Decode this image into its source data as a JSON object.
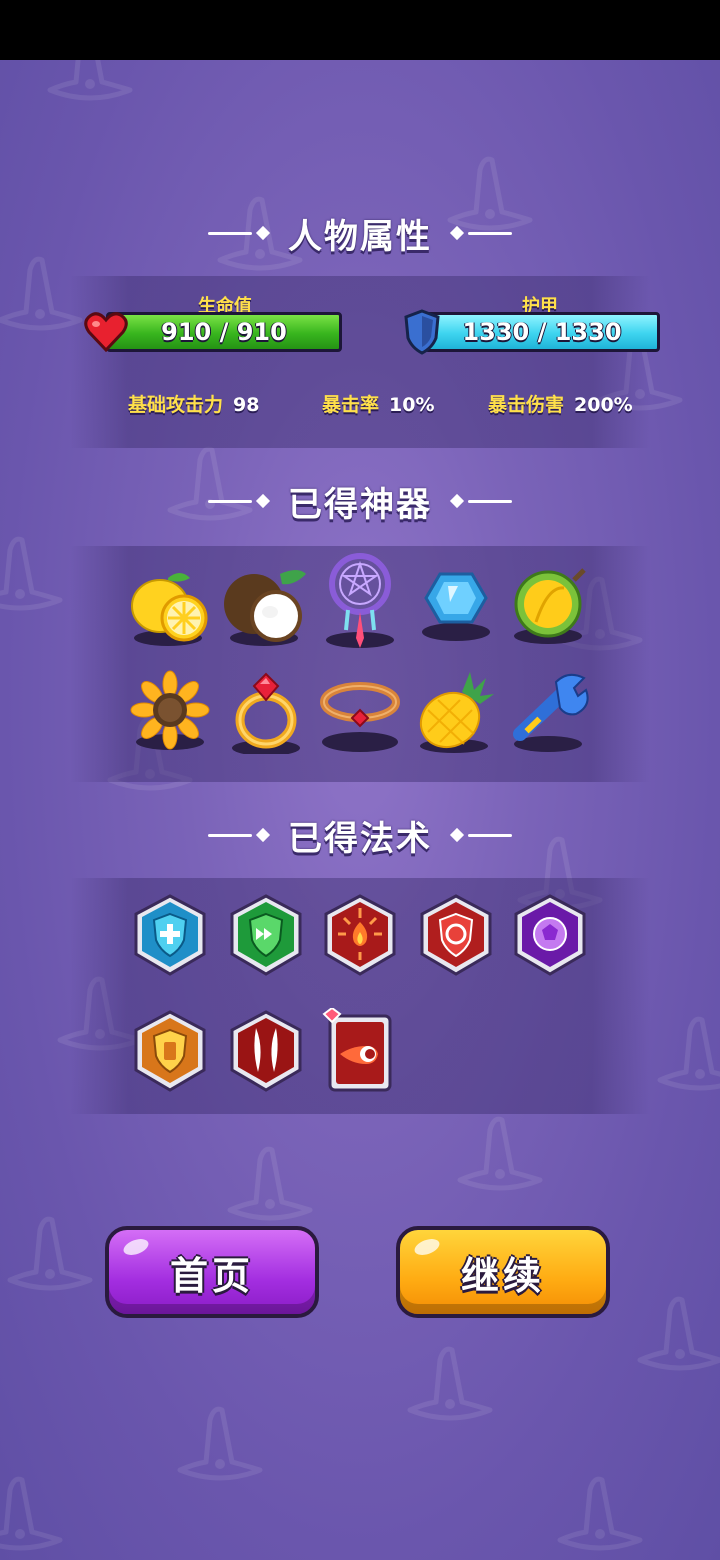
{
  "sections": {
    "attributes_title": "人物属性",
    "artifacts_title": "已得神器",
    "spells_title": "已得法术"
  },
  "stats": {
    "hp_label": "生命值",
    "hp_value": "910 / 910",
    "armor_label": "护甲",
    "armor_value": "1330 / 1330",
    "attack_label": "基础攻击力",
    "attack_value": "98",
    "crit_rate_label": "暴击率",
    "crit_rate_value": "10%",
    "crit_damage_label": "暴击伤害",
    "crit_damage_value": "200%"
  },
  "artifacts": [
    {
      "icon": "lemon-icon"
    },
    {
      "icon": "coconut-icon"
    },
    {
      "icon": "dreamcatcher-icon"
    },
    {
      "icon": "blue-gem-icon"
    },
    {
      "icon": "durian-icon"
    },
    {
      "icon": "sunflower-icon"
    },
    {
      "icon": "ruby-ring-icon"
    },
    {
      "icon": "bracelet-icon"
    },
    {
      "icon": "pineapple-icon"
    },
    {
      "icon": "wrench-icon"
    }
  ],
  "spells": [
    {
      "icon": "heal-shield-icon"
    },
    {
      "icon": "speed-shield-icon"
    },
    {
      "icon": "fire-burst-icon"
    },
    {
      "icon": "fire-shield-icon"
    },
    {
      "icon": "turtle-shell-icon"
    },
    {
      "icon": "energy-shield-icon"
    },
    {
      "icon": "twin-claws-icon"
    },
    {
      "icon": "fireball-card-icon"
    }
  ],
  "buttons": {
    "home": "首页",
    "continue": "继续"
  },
  "colors": {
    "background": "#7a63b8",
    "stat_label": "#ffe04a",
    "hp_bar": "#38b51e",
    "armor_bar": "#3dd4ef",
    "home_button": "#a32ee0",
    "continue_button": "#ffab12"
  }
}
